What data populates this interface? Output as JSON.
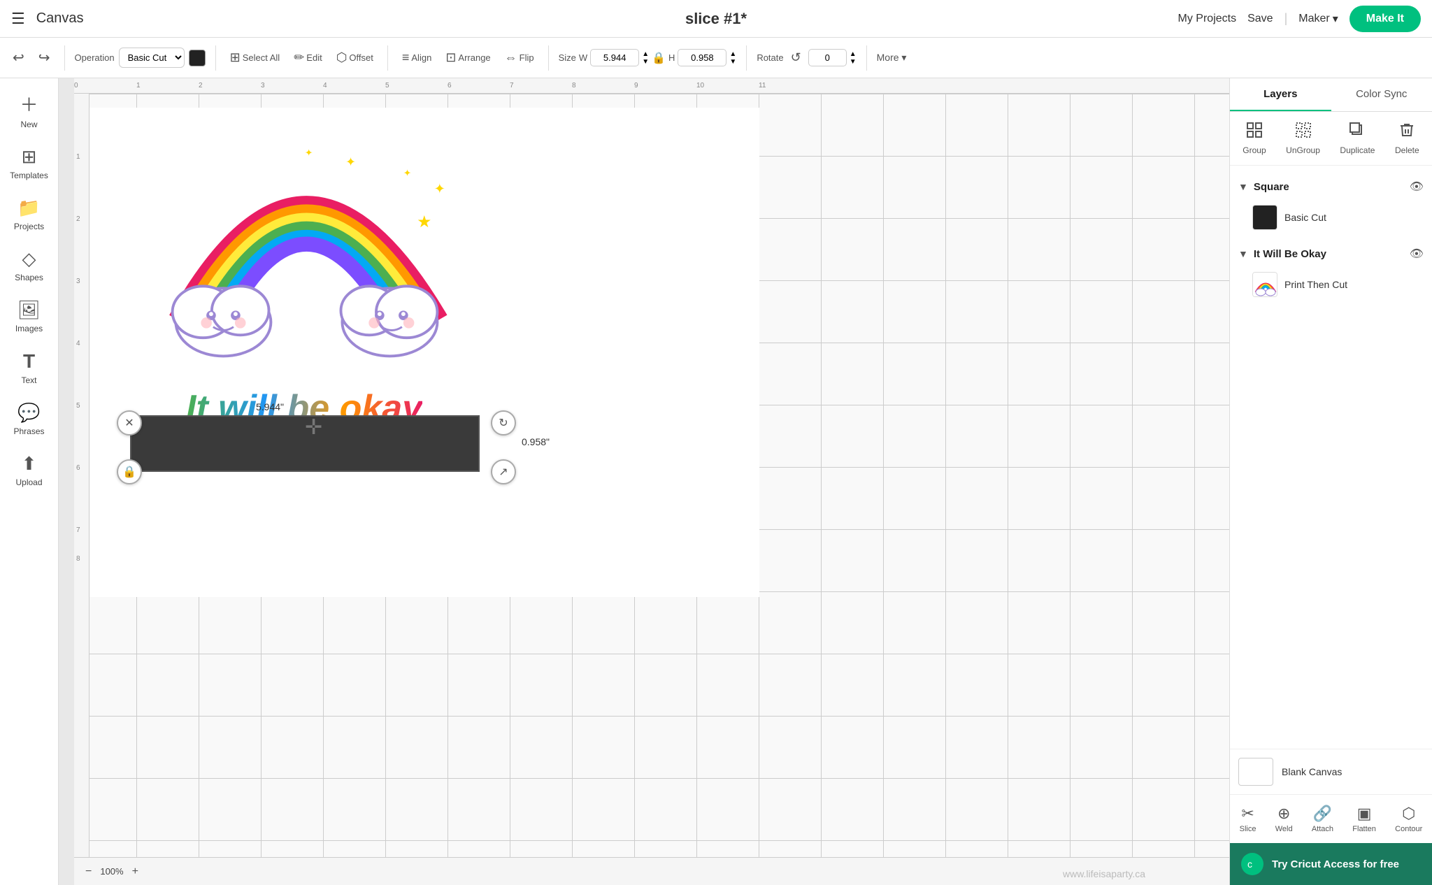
{
  "topbar": {
    "hamburger_icon": "☰",
    "canvas_label": "Canvas",
    "slice_title": "slice #1*",
    "my_projects_label": "My Projects",
    "save_label": "Save",
    "maker_label": "Maker",
    "make_it_label": "Make It"
  },
  "toolbar": {
    "undo_icon": "↩",
    "redo_icon": "↪",
    "operation_label": "Operation",
    "operation_value": "Basic Cut",
    "select_all_label": "Select All",
    "edit_label": "Edit",
    "offset_label": "Offset",
    "align_label": "Align",
    "arrange_label": "Arrange",
    "flip_label": "Flip",
    "size_label": "Size",
    "width_label": "W",
    "width_value": "5.944",
    "height_label": "H",
    "height_value": "0.958",
    "rotate_label": "Rotate",
    "rotate_value": "0",
    "more_label": "More ▾"
  },
  "left_sidebar": {
    "items": [
      {
        "icon": "＋",
        "label": "New"
      },
      {
        "icon": "⊞",
        "label": "Templates"
      },
      {
        "icon": "📁",
        "label": "Projects"
      },
      {
        "icon": "◇",
        "label": "Shapes"
      },
      {
        "icon": "🖼",
        "label": "Images"
      },
      {
        "icon": "T",
        "label": "Text"
      },
      {
        "icon": "💬",
        "label": "Phrases"
      },
      {
        "icon": "⬆",
        "label": "Upload"
      }
    ]
  },
  "canvas": {
    "zoom_minus": "−",
    "zoom_level": "100%",
    "zoom_plus": "+",
    "dim_width": "5.944\"",
    "dim_height": "0.958\"",
    "watermark": "www.lifeisaparty.ca"
  },
  "design": {
    "text": "It will be okay"
  },
  "right_panel": {
    "tabs": [
      {
        "label": "Layers",
        "active": true
      },
      {
        "label": "Color Sync",
        "active": false
      }
    ],
    "actions": [
      {
        "icon": "⊞",
        "label": "Group",
        "disabled": false
      },
      {
        "icon": "⊟",
        "label": "UnGroup",
        "disabled": false
      },
      {
        "icon": "⧉",
        "label": "Duplicate",
        "disabled": false
      },
      {
        "icon": "🗑",
        "label": "Delete",
        "disabled": false
      }
    ],
    "layer_groups": [
      {
        "name": "Square",
        "expanded": true,
        "items": [
          {
            "label": "Basic Cut",
            "type": "Basic Cut",
            "color": "#222222"
          }
        ]
      },
      {
        "name": "It Will Be Okay",
        "expanded": true,
        "items": [
          {
            "label": "Print Then Cut",
            "type": "Print Then Cut",
            "thumb": "rainbow"
          }
        ]
      }
    ],
    "blank_canvas_label": "Blank Canvas",
    "bottom_tools": [
      {
        "icon": "✂",
        "label": "Slice"
      },
      {
        "icon": "⊕",
        "label": "Weld"
      },
      {
        "icon": "🔗",
        "label": "Attach"
      },
      {
        "icon": "▣",
        "label": "Flatten"
      },
      {
        "icon": "⬡",
        "label": "Contour"
      }
    ],
    "cta_text": "Try Cricut Access for free"
  }
}
